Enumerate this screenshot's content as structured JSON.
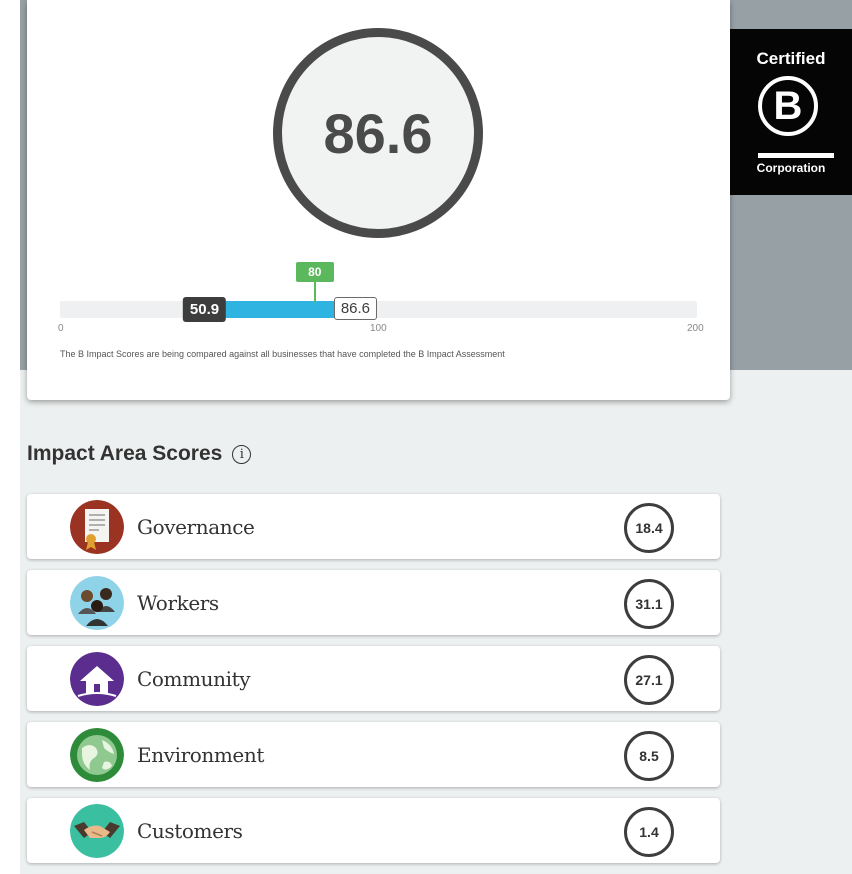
{
  "overall": {
    "score": "86.6",
    "score_value": 86.6,
    "benchmark_label": "80",
    "benchmark_value": 80,
    "median_label": "50.9",
    "median_value": 50.9,
    "company_label": "86.6",
    "axis_min": "0",
    "axis_mid": "100",
    "axis_max": "200",
    "footnote": "The B Impact Scores are being compared against all businesses that have completed the B Impact Assessment"
  },
  "certification": {
    "top_text": "Certified",
    "letter": "B",
    "bottom_text": "Corporation"
  },
  "impact_areas": {
    "title": "Impact Area Scores",
    "items": [
      {
        "name": "Governance",
        "score": "18.4",
        "icon": "governance-certificate-icon",
        "color": "#9b3322"
      },
      {
        "name": "Workers",
        "score": "31.1",
        "icon": "workers-people-icon",
        "color": "#8fd3e8"
      },
      {
        "name": "Community",
        "score": "27.1",
        "icon": "community-house-icon",
        "color": "#5b2d8e"
      },
      {
        "name": "Environment",
        "score": "8.5",
        "icon": "environment-globe-icon",
        "color": "#2e8b3a"
      },
      {
        "name": "Customers",
        "score": "1.4",
        "icon": "customers-handshake-icon",
        "color": "#3bbfa1"
      }
    ]
  },
  "colors": {
    "track_fill": "#2fb3e0",
    "benchmark": "#5cb85c",
    "median_badge": "#3d3d3d"
  }
}
